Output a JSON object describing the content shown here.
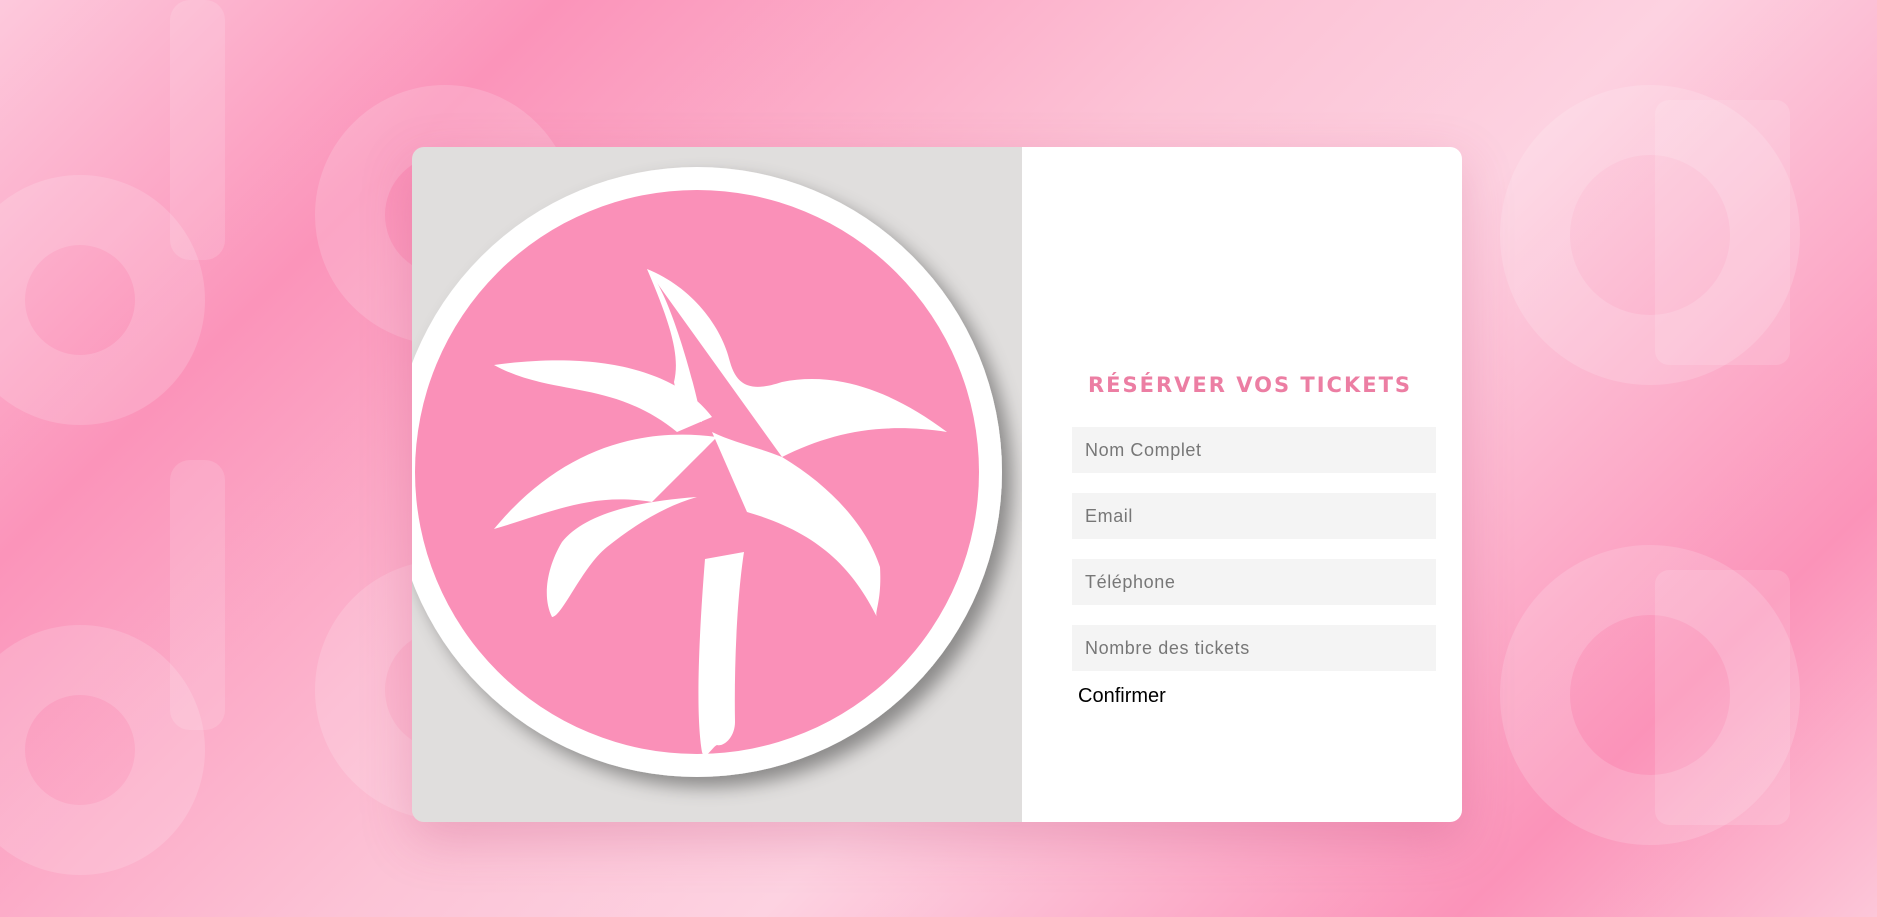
{
  "colors": {
    "page_pink": "#fb94ba",
    "logo_pink": "#fa90b8",
    "title_pink": "#ec7ea3",
    "left_panel_bg": "#e0dedd",
    "field_bg": "#f4f4f4"
  },
  "booking": {
    "logo_icon": "palm-tree-icon",
    "title": "RÉSÉRVER VOS TICKETS",
    "fields": {
      "name_placeholder": "Nom Complet",
      "email_placeholder": "Email",
      "phone_placeholder": "Téléphone",
      "tickets_placeholder": "Nombre des tickets"
    },
    "confirm_label": "Confirmer"
  }
}
